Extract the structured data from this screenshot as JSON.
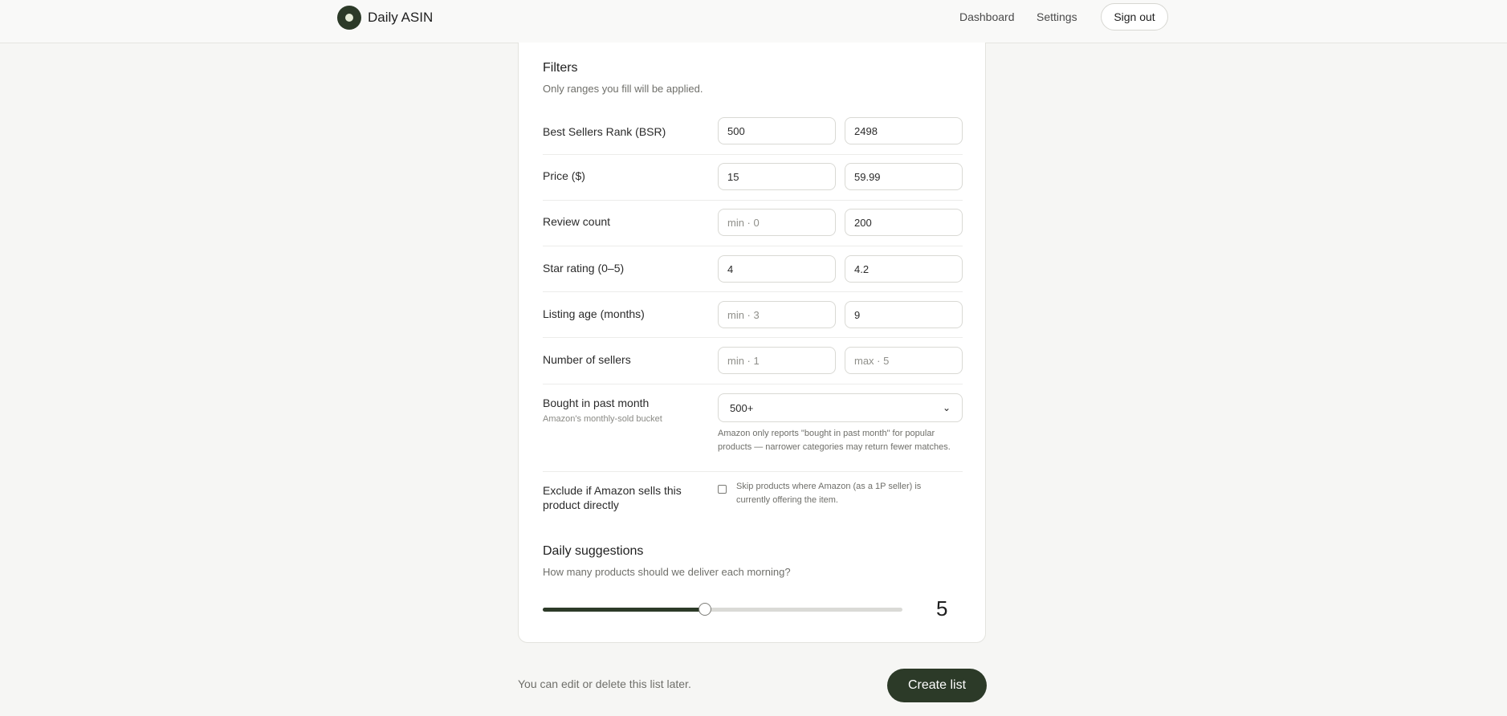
{
  "header": {
    "brand": "Daily ASIN",
    "nav": [
      "Dashboard",
      "Settings"
    ],
    "signout": "Sign out"
  },
  "filters": {
    "title": "Filters",
    "subtitle": "Only ranges you fill will be applied.",
    "bsr": {
      "label": "Best Sellers Rank (BSR)",
      "min": "500",
      "max": "2498"
    },
    "price": {
      "label": "Price ($)",
      "min": "15",
      "max": "59.99"
    },
    "reviews": {
      "label": "Review count",
      "min_placeholder": "min · 0",
      "max": "200"
    },
    "rating": {
      "label": "Star rating (0–5)",
      "min": "4",
      "max": "4.2"
    },
    "age": {
      "label": "Listing age (months)",
      "min_placeholder": "min · 3",
      "max": "9"
    },
    "sellers": {
      "label": "Number of sellers",
      "min_placeholder": "min · 1",
      "max_placeholder": "max · 5"
    },
    "bought": {
      "label": "Bought in past month",
      "hint": "Amazon's monthly-sold bucket",
      "selected": "500+",
      "note": "Amazon only reports \"bought in past month\" for popular products — narrower categories may return fewer matches."
    },
    "exclude": {
      "label": "Exclude if Amazon sells this product directly",
      "checkbox_text": "Skip products where Amazon (as a 1P seller) is currently offering the item.",
      "checked": false
    }
  },
  "daily": {
    "title": "Daily suggestions",
    "subtitle": "How many products should we deliver each morning?",
    "value": "5",
    "fraction": 0.45
  },
  "footer": {
    "note": "You can edit or delete this list later.",
    "create": "Create list"
  }
}
